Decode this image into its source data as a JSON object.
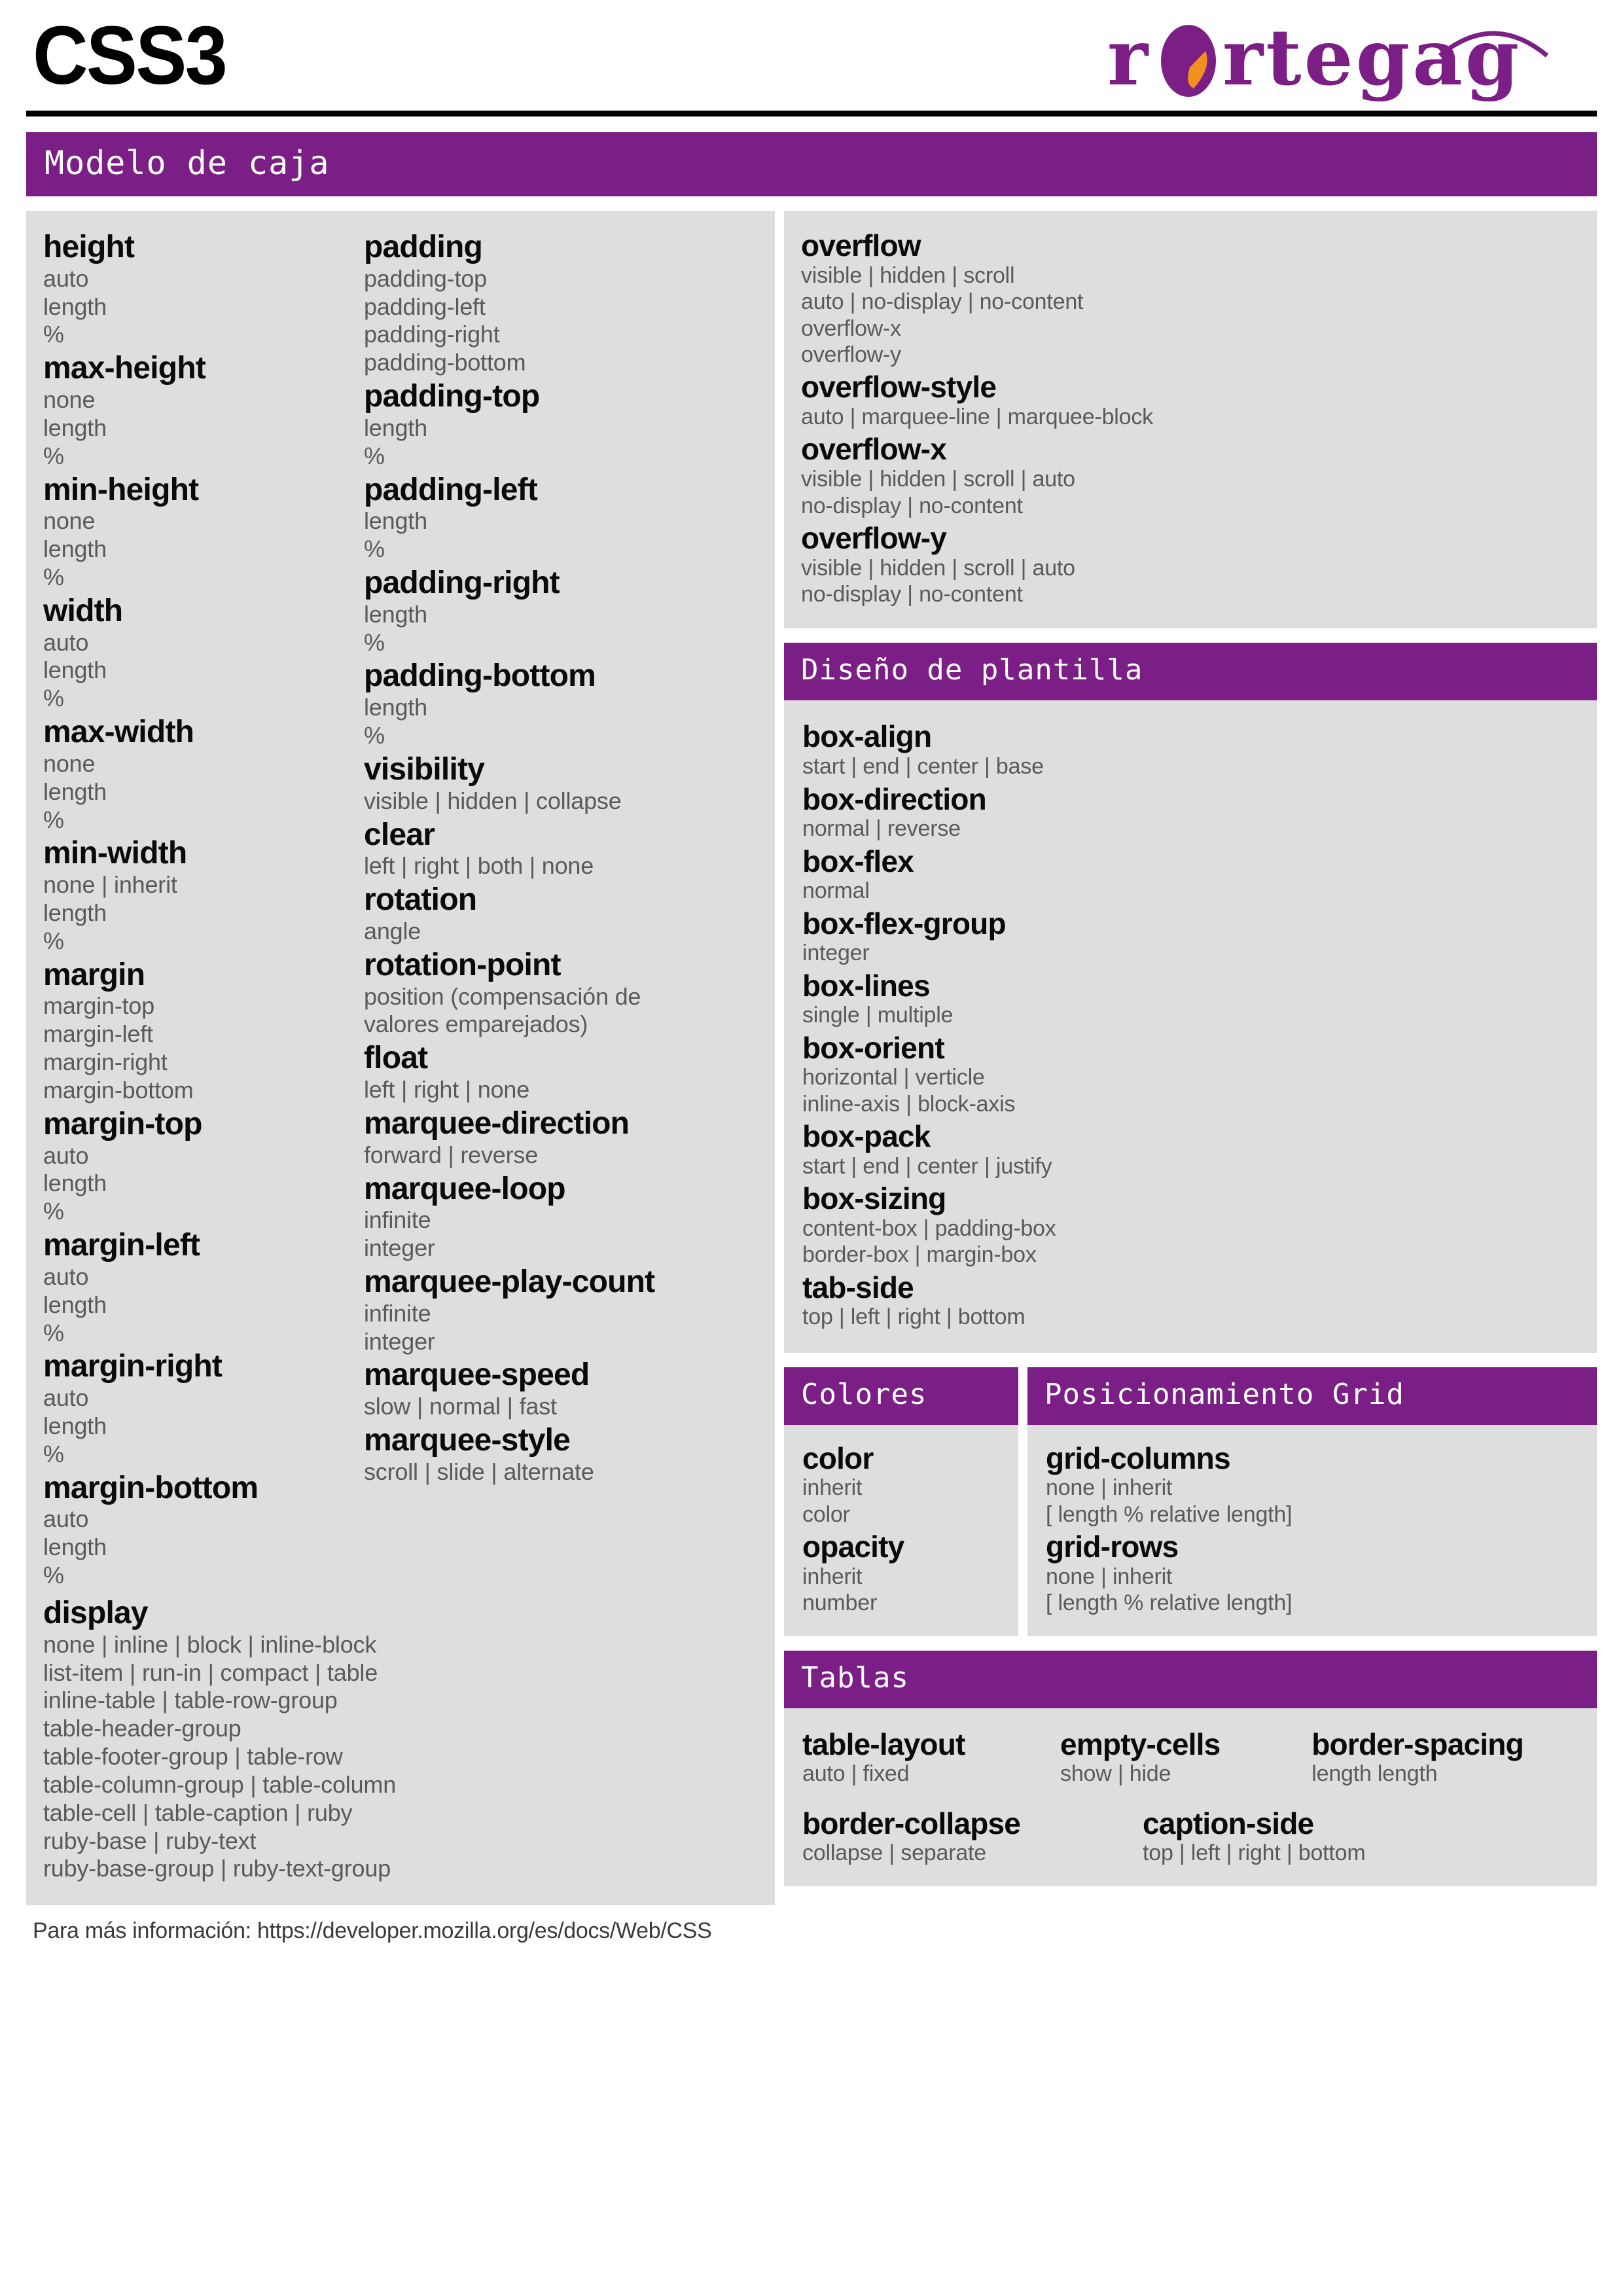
{
  "masthead": {
    "title": "CSS3",
    "logo_text": "rortegag",
    "logo_color": "#7B1E85",
    "logo_accent_color": "#F0901E"
  },
  "colors": {
    "header_purple": "#7B1E85",
    "panel_gray": "#dedede",
    "property_black": "#0a0a0a",
    "value_gray": "#5a5a5a"
  },
  "sections": {
    "box_model": {
      "title": "Modelo de caja",
      "column_1": [
        {
          "property": "height",
          "values": [
            "auto",
            "length",
            "%"
          ]
        },
        {
          "property": "max-height",
          "values": [
            "none",
            "length",
            "%"
          ]
        },
        {
          "property": "min-height",
          "values": [
            "none",
            "length",
            "%"
          ]
        },
        {
          "property": "width",
          "values": [
            "auto",
            "length",
            "%"
          ]
        },
        {
          "property": "max-width",
          "values": [
            "none",
            "length",
            "%"
          ]
        },
        {
          "property": "min-width",
          "values": [
            "none | inherit",
            "length",
            "%"
          ]
        },
        {
          "property": "margin",
          "values": [
            "margin-top",
            "margin-left",
            "margin-right",
            "margin-bottom"
          ]
        },
        {
          "property": "margin-top",
          "values": [
            "auto",
            "length",
            "%"
          ]
        },
        {
          "property": "margin-left",
          "values": [
            "auto",
            "length",
            "%"
          ]
        },
        {
          "property": "margin-right",
          "values": [
            "auto",
            "length",
            "%"
          ]
        },
        {
          "property": "margin-bottom",
          "values": [
            "auto",
            "length",
            "%"
          ]
        },
        {
          "property": "display",
          "values": [
            "none | inline | block | inline-block",
            "list-item | run-in | compact | table",
            "inline-table | table-row-group",
            "table-header-group",
            "table-footer-group | table-row",
            "table-column-group | table-column",
            "table-cell | table-caption | ruby",
            "ruby-base | ruby-text",
            "ruby-base-group | ruby-text-group"
          ]
        }
      ],
      "column_2": [
        {
          "property": "padding",
          "values": [
            "padding-top",
            "padding-left",
            "padding-right",
            "padding-bottom"
          ]
        },
        {
          "property": "padding-top",
          "values": [
            "length",
            "%"
          ]
        },
        {
          "property": "padding-left",
          "values": [
            "length",
            "%"
          ]
        },
        {
          "property": "padding-right",
          "values": [
            "length",
            "%"
          ]
        },
        {
          "property": "padding-bottom",
          "values": [
            "length",
            "%"
          ]
        },
        {
          "property": "visibility",
          "values": [
            "visible | hidden | collapse"
          ]
        },
        {
          "property": "clear",
          "values": [
            "left | right | both | none"
          ]
        },
        {
          "property": "rotation",
          "values": [
            "angle"
          ]
        },
        {
          "property": "rotation-point",
          "values": [
            "position (compensación de",
            "valores emparejados)"
          ]
        },
        {
          "property": "float",
          "values": [
            "left | right | none"
          ]
        },
        {
          "property": "marquee-direction",
          "values": [
            "forward | reverse"
          ]
        },
        {
          "property": "marquee-loop",
          "values": [
            "infinite",
            "integer"
          ]
        },
        {
          "property": "marquee-play-count",
          "values": [
            "infinite",
            "integer"
          ]
        },
        {
          "property": "marquee-speed",
          "values": [
            "slow | normal | fast"
          ]
        },
        {
          "property": "marquee-style",
          "values": [
            "scroll | slide | alternate"
          ]
        }
      ],
      "column_3": [
        {
          "property": "overflow",
          "values": [
            "visible | hidden | scroll",
            "auto | no-display | no-content",
            "overflow-x",
            "overflow-y"
          ]
        },
        {
          "property": "overflow-style",
          "values": [
            "auto | marquee-line | marquee-block"
          ]
        },
        {
          "property": "overflow-x",
          "values": [
            "visible | hidden | scroll | auto",
            "no-display | no-content"
          ]
        },
        {
          "property": "overflow-y",
          "values": [
            "visible | hidden | scroll | auto",
            "no-display | no-content"
          ]
        }
      ]
    },
    "template_design": {
      "title": "Diseño de plantilla",
      "items": [
        {
          "property": "box-align",
          "values": [
            "start | end | center | base"
          ]
        },
        {
          "property": "box-direction",
          "values": [
            "normal | reverse"
          ]
        },
        {
          "property": "box-flex",
          "values": [
            "normal"
          ]
        },
        {
          "property": "box-flex-group",
          "values": [
            "integer"
          ]
        },
        {
          "property": "box-lines",
          "values": [
            "single | multiple"
          ]
        },
        {
          "property": "box-orient",
          "values": [
            "horizontal | verticle",
            "inline-axis | block-axis"
          ]
        },
        {
          "property": "box-pack",
          "values": [
            "start | end | center | justify"
          ]
        },
        {
          "property": "box-sizing",
          "values": [
            "content-box | padding-box",
            "border-box | margin-box"
          ]
        },
        {
          "property": "tab-side",
          "values": [
            "top | left | right | bottom"
          ]
        }
      ]
    },
    "colors_section": {
      "title": "Colores",
      "items": [
        {
          "property": "color",
          "values": [
            "inherit",
            "color"
          ]
        },
        {
          "property": "opacity",
          "values": [
            "inherit",
            "number"
          ]
        }
      ]
    },
    "grid_positioning": {
      "title": "Posicionamiento Grid",
      "items": [
        {
          "property": "grid-columns",
          "values": [
            "none | inherit",
            "[ length % relative length]"
          ]
        },
        {
          "property": "grid-rows",
          "values": [
            "none | inherit",
            "[ length % relative length]"
          ]
        }
      ]
    },
    "tables": {
      "title": "Tablas",
      "row_1": [
        {
          "property": "table-layout",
          "values": [
            "auto | fixed"
          ]
        },
        {
          "property": "empty-cells",
          "values": [
            "show | hide"
          ]
        },
        {
          "property": "border-spacing",
          "values": [
            "length length"
          ]
        }
      ],
      "row_2": [
        {
          "property": "border-collapse",
          "values": [
            "collapse | separate"
          ]
        },
        {
          "property": "caption-side",
          "values": [
            "top | left | right | bottom"
          ]
        }
      ]
    }
  },
  "footer": {
    "text": "Para más información: https://developer.mozilla.org/es/docs/Web/CSS"
  }
}
